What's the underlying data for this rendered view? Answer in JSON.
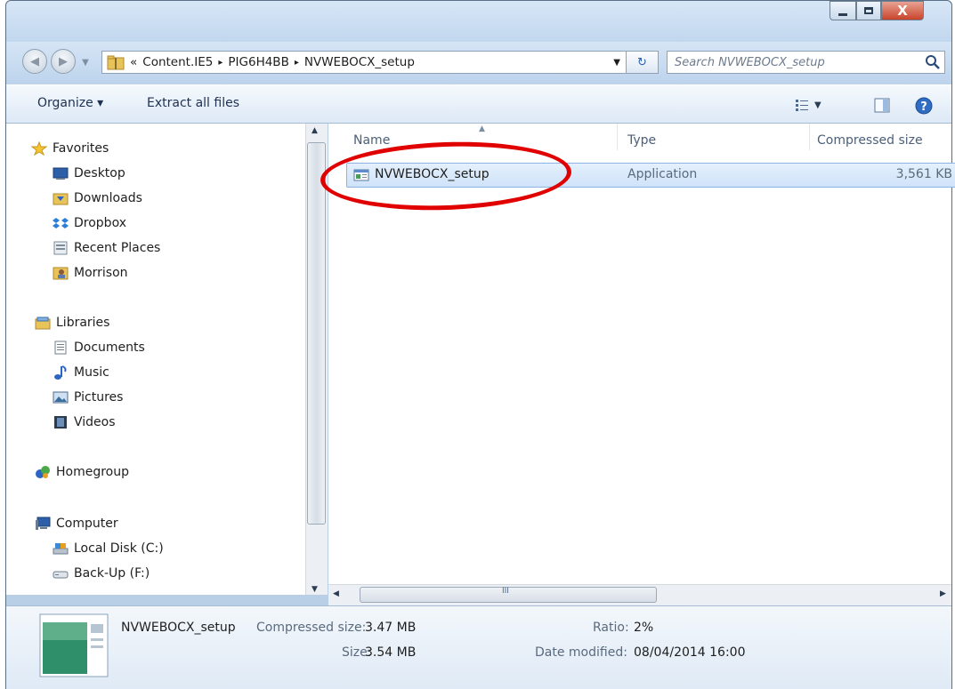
{
  "window": {
    "close_symbol": "X"
  },
  "address": {
    "overflow": "«",
    "crumbs": [
      "Content.IE5",
      "PIG6H4BB",
      "NVWEBOCX_setup"
    ],
    "separator": "▸"
  },
  "search": {
    "placeholder": "Search NVWEBOCX_setup"
  },
  "toolbar": {
    "organize": "Organize ▾",
    "extract": "Extract all files"
  },
  "nav": {
    "favorites": {
      "label": "Favorites",
      "items": [
        "Desktop",
        "Downloads",
        "Dropbox",
        "Recent Places",
        "Morrison"
      ]
    },
    "libraries": {
      "label": "Libraries",
      "items": [
        "Documents",
        "Music",
        "Pictures",
        "Videos"
      ]
    },
    "homegroup": "Homegroup",
    "computer": {
      "label": "Computer",
      "items": [
        "Local Disk (C:)",
        "Back-Up (F:)"
      ]
    }
  },
  "columns": {
    "name": "Name",
    "type": "Type",
    "compressed_size": "Compressed size"
  },
  "files": [
    {
      "name": "NVWEBOCX_setup",
      "type": "Application",
      "compressed_size": "3,561 KB"
    }
  ],
  "hscroll_grip": "III",
  "details": {
    "filename": "NVWEBOCX_setup",
    "compressed_label": "Compressed size:",
    "compressed_value": "3.47 MB",
    "size_label": "Size:",
    "size_value": "3.54 MB",
    "ratio_label": "Ratio:",
    "ratio_value": "2%",
    "modified_label": "Date modified:",
    "modified_value": "08/04/2014 16:00"
  },
  "colors": {
    "selection": "#cfe3f9",
    "highlight_ring": "#e00000"
  }
}
